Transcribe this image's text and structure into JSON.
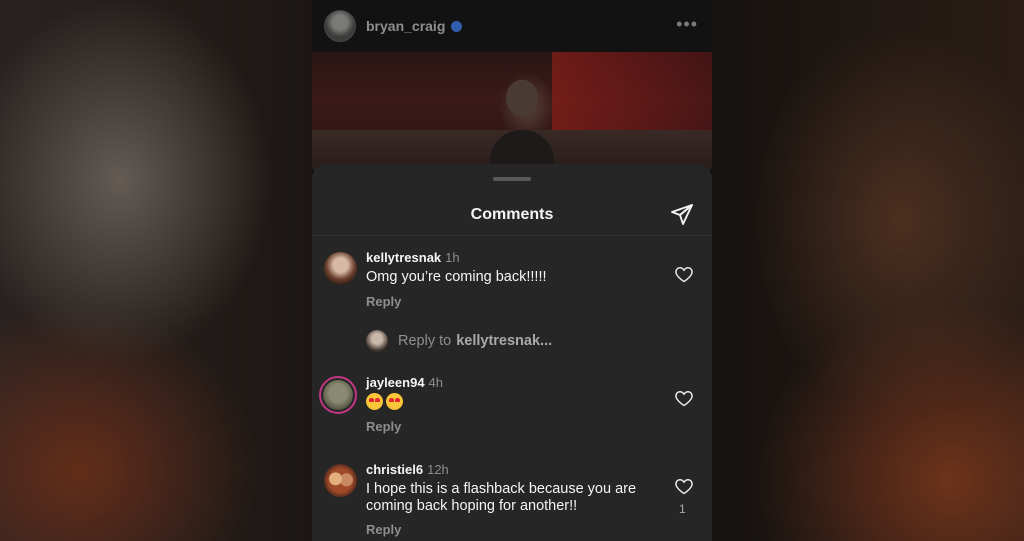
{
  "post": {
    "username": "bryan_craig",
    "more_label": "•••"
  },
  "sheet": {
    "title": "Comments"
  },
  "comments": [
    {
      "username": "kellytresnak",
      "time": "1h",
      "text": "Omg you’re coming back!!!!!",
      "reply_label": "Reply"
    },
    {
      "username": "jayleen94",
      "time": "4h",
      "text": "😍😍",
      "reply_label": "Reply"
    },
    {
      "username": "christiel6",
      "time": "12h",
      "text": "I hope this is a flashback because you are coming back hoping for another!!",
      "reply_label": "Reply",
      "likes": "1"
    }
  ],
  "reply_input": {
    "prefix": "Reply to",
    "target": "kellytresnak..."
  },
  "colors": {
    "sheet_bg": "#262626",
    "accent_verified": "#3b6fd6",
    "text_primary": "#f5f5f5",
    "text_secondary": "#8e8e8e"
  }
}
